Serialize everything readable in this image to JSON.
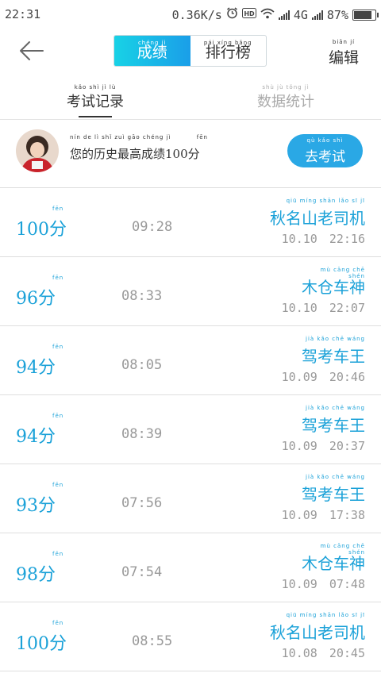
{
  "status_bar": {
    "time": "22:31",
    "speed": "0.36K/s",
    "network": "4G",
    "battery": "87%",
    "battery_level": 0.87,
    "icons": [
      "alarm-icon",
      "hd-icon",
      "wifi-icon",
      "signal-icon",
      "signal-4g-icon",
      "battery-icon"
    ]
  },
  "header": {
    "back_icon": "arrow-left-icon",
    "segment": {
      "active_pinyin": "chéng jì",
      "active_label": "成绩",
      "other_pinyin": "pái xíng bǎng",
      "other_label": "排行榜"
    },
    "edit_pinyin": "biān jí",
    "edit_label": "编辑"
  },
  "tabs": {
    "record_pinyin": "kǎo shì jì lù",
    "record_label": "考试记录",
    "stats_pinyin": "shù jù tǒng jì",
    "stats_label": "数据统计"
  },
  "best": {
    "pinyin": "nín de lì shǐ zuì gāo chéng jì          fēn",
    "text": "您的历史最高成绩100分",
    "button_pinyin": "qù kǎo shì",
    "button_label": "去考试"
  },
  "colors": {
    "accent": "#1aa1d8",
    "button": "#2aa8e5",
    "gradient_start": "#18d2e6",
    "gradient_end": "#1a9ee8"
  },
  "records": [
    {
      "score": "100分",
      "duration": "09:28",
      "title_pinyin": "qiū míng shān lǎo sī jī",
      "title": "秋名山老司机",
      "date": "10.10",
      "time": "22:16"
    },
    {
      "score": "96分",
      "duration": "08:33",
      "title_pinyin": "mù cāng chē shén",
      "title": "木仓车神",
      "date": "10.10",
      "time": "22:07"
    },
    {
      "score": "94分",
      "duration": "08:05",
      "title_pinyin": "jià kǎo chē wáng",
      "title": "驾考车王",
      "date": "10.09",
      "time": "20:46"
    },
    {
      "score": "94分",
      "duration": "08:39",
      "title_pinyin": "jià kǎo chē wáng",
      "title": "驾考车王",
      "date": "10.09",
      "time": "20:37"
    },
    {
      "score": "93分",
      "duration": "07:56",
      "title_pinyin": "jià kǎo chē wáng",
      "title": "驾考车王",
      "date": "10.09",
      "time": "17:38"
    },
    {
      "score": "98分",
      "duration": "07:54",
      "title_pinyin": "mù cāng chē shén",
      "title": "木仓车神",
      "date": "10.09",
      "time": "07:48"
    },
    {
      "score": "100分",
      "duration": "08:55",
      "title_pinyin": "qiū míng shān lǎo sī jī",
      "title": "秋名山老司机",
      "date": "10.08",
      "time": "20:45"
    }
  ],
  "score_pinyin": "fēn"
}
